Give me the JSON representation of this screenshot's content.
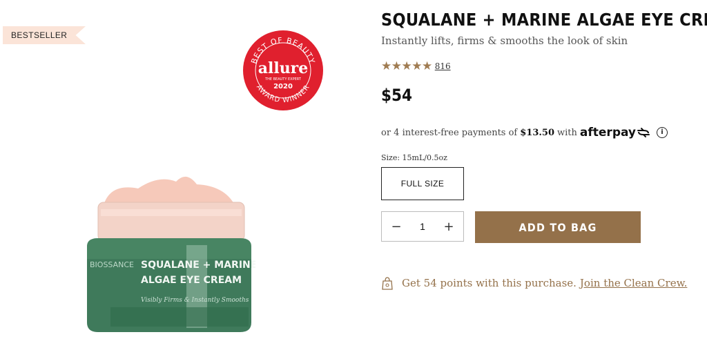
{
  "badge": {
    "label": "BESTSELLER"
  },
  "seal": {
    "top_text": "BEST OF BEAUTY",
    "brand": "allure",
    "tagline": "THE BEAUTY EXPERT",
    "year": "2020",
    "bottom_text": "AWARD WINNER",
    "color": "#e0202e"
  },
  "jar": {
    "brand_text": "BIOSSANCE",
    "line1": "SQUALANE + MARINE",
    "line2": "ALGAE EYE CREAM",
    "tagline": "Visibly Firms & Instantly Smooths"
  },
  "product": {
    "title": "SQUALANE + MARINE ALGAE EYE CREAM",
    "subtitle": "Instantly lifts, firms & smooths the look of skin",
    "rating_stars": "★★★★★",
    "review_count": "816",
    "price": "$54"
  },
  "afterpay": {
    "prefix": "or 4 interest-free payments of",
    "amount": "$13.50",
    "with": "with",
    "logo": "afterpay",
    "info_icon": "info-icon"
  },
  "size": {
    "label": "Size: 15mL/0.5oz",
    "option": "FULL SIZE"
  },
  "quantity": {
    "minus": "−",
    "value": "1",
    "plus": "+"
  },
  "cta": {
    "add_to_bag": "ADD TO BAG",
    "color": "#94714a"
  },
  "points": {
    "text": "Get 54 points with this purchase.",
    "link": "Join the Clean Crew."
  }
}
